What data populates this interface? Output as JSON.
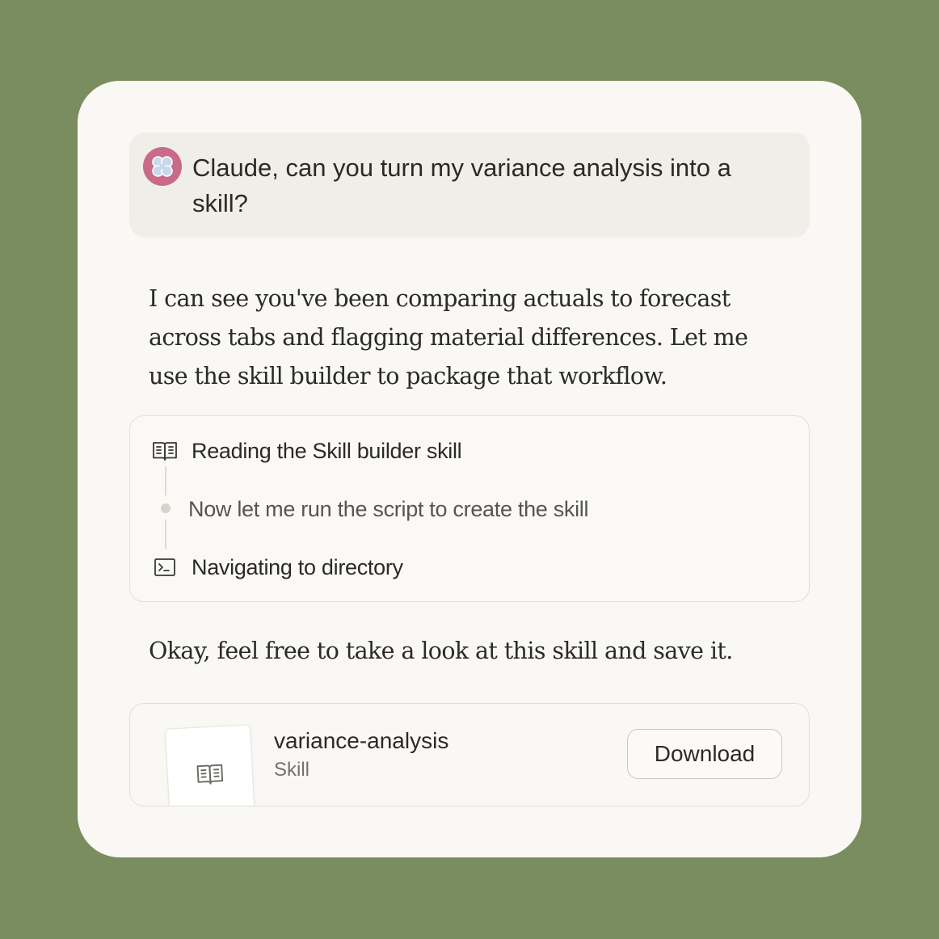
{
  "user_message": {
    "avatar_icon": "claude-flower-icon",
    "text": "Claude, can you turn my variance analysis into a skill?"
  },
  "assistant": {
    "message_1": "I can see you've been comparing actuals to forecast across tabs and flagging material differences. Let me use the skill builder to package that workflow.",
    "steps": [
      {
        "icon": "book-icon",
        "label": "Reading the Skill builder skill"
      },
      {
        "icon": "dot",
        "label": "Now let me run the script to create the skill"
      },
      {
        "icon": "terminal-icon",
        "label": "Navigating to directory"
      }
    ],
    "message_2": "Okay, feel free to take a look at this skill and save it."
  },
  "artifact": {
    "icon": "book-icon",
    "name": "variance-analysis",
    "type": "Skill",
    "download_label": "Download"
  },
  "colors": {
    "background": "#7a8d5e",
    "card": "#f9f8f4",
    "avatar": "#c96a88"
  }
}
